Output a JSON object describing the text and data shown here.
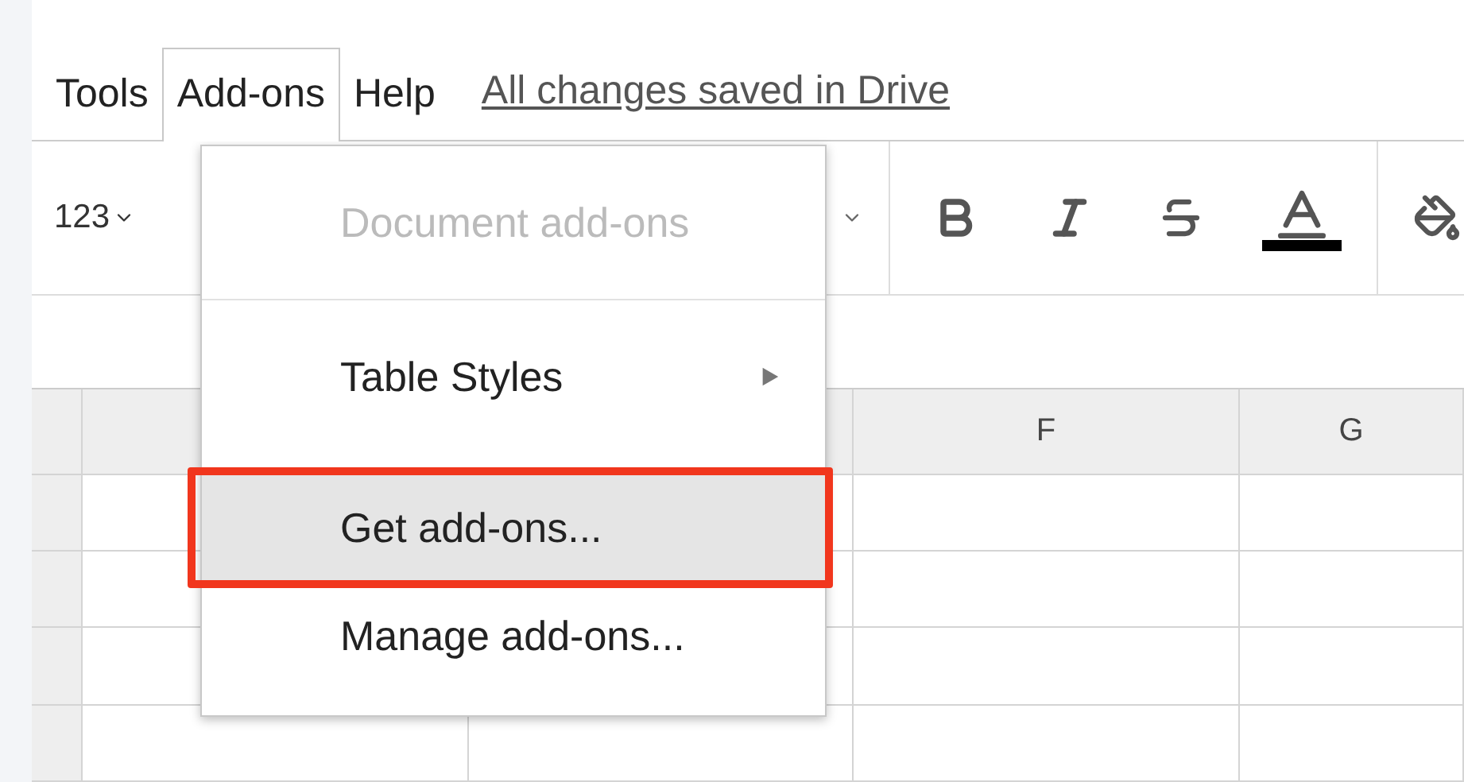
{
  "menu_bar": {
    "items": [
      {
        "label": "Tools",
        "selected": false
      },
      {
        "label": "Add-ons",
        "selected": true
      },
      {
        "label": "Help",
        "selected": false
      }
    ],
    "save_status": "All changes saved in Drive"
  },
  "toolbar": {
    "number_format": "123"
  },
  "dropdown": {
    "items": [
      {
        "label": "Document add-ons",
        "disabled": true,
        "selected": false,
        "submenu": false
      },
      {
        "label": "Table Styles",
        "disabled": false,
        "selected": false,
        "submenu": true
      },
      {
        "label": "Get add-ons...",
        "disabled": false,
        "selected": true,
        "submenu": false
      },
      {
        "label": "Manage add-ons...",
        "disabled": false,
        "selected": false,
        "submenu": false
      }
    ]
  },
  "sheet": {
    "column_headers": [
      "F",
      "G"
    ]
  }
}
